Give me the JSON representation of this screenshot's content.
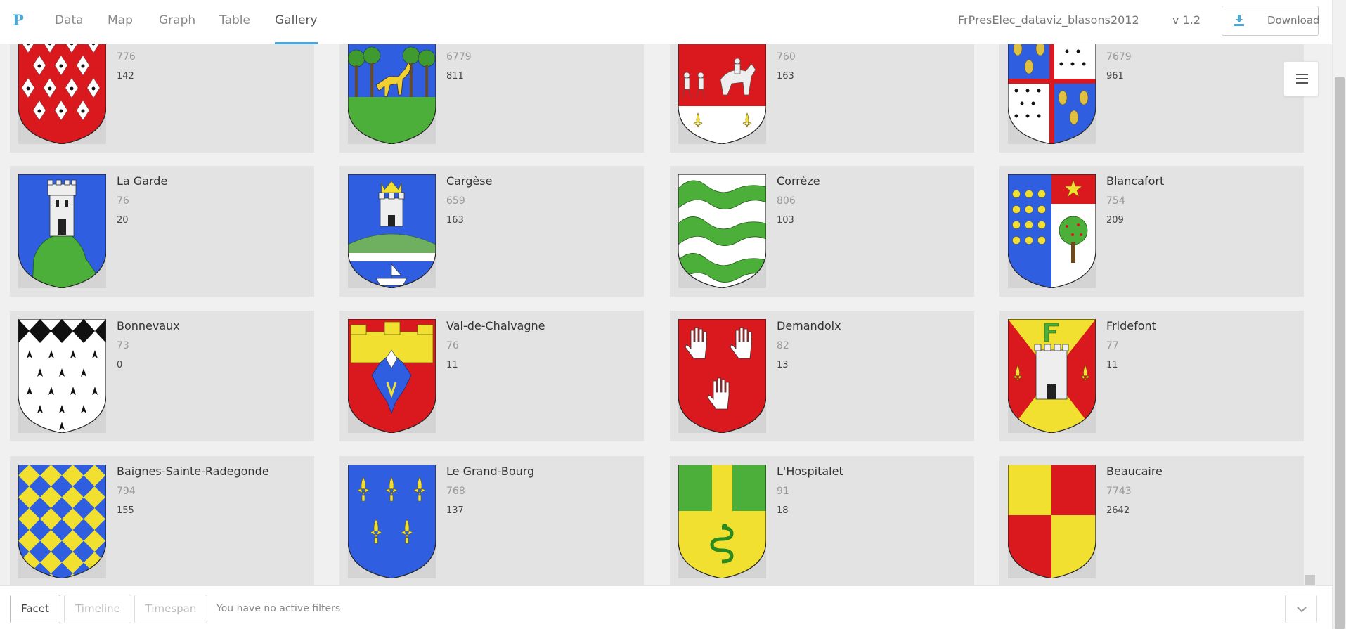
{
  "app": {
    "logo": "P",
    "nav_tabs": [
      "Data",
      "Map",
      "Graph",
      "Table",
      "Gallery"
    ],
    "active_tab": "Gallery",
    "project_title": "FrPresElec_dataviz_blasons2012",
    "version": "v 1.2",
    "download_label": "Download"
  },
  "gallery": {
    "cards": [
      {
        "title": "",
        "v1": "776",
        "v2": "142",
        "icon": "ermine-shield-icon"
      },
      {
        "title": "",
        "v1": "6779",
        "v2": "811",
        "icon": "stag-forest-shield-icon"
      },
      {
        "title": "",
        "v1": "760",
        "v2": "163",
        "icon": "riders-fleur-de-lis-shield-icon"
      },
      {
        "title": "",
        "v1": "7679",
        "v2": "961",
        "icon": "quartered-wheat-ermine-shield-icon"
      },
      {
        "title": "La Garde",
        "v1": "76",
        "v2": "20",
        "icon": "tower-on-rock-shield-icon"
      },
      {
        "title": "Cargèse",
        "v1": "659",
        "v2": "163",
        "icon": "crowned-tower-ship-shield-icon"
      },
      {
        "title": "Corrèze",
        "v1": "806",
        "v2": "103",
        "icon": "green-waves-shield-icon"
      },
      {
        "title": "Blancafort",
        "v1": "754",
        "v2": "209",
        "icon": "bezants-star-tree-shield-icon"
      },
      {
        "title": "Bonnevaux",
        "v1": "73",
        "v2": "0",
        "icon": "ermine-chief-shield-icon"
      },
      {
        "title": "Val-de-Chalvagne",
        "v1": "76",
        "v2": "11",
        "icon": "castle-eagle-shield-icon"
      },
      {
        "title": "Demandolx",
        "v1": "82",
        "v2": "13",
        "icon": "three-hands-shield-icon"
      },
      {
        "title": "Fridefont",
        "v1": "77",
        "v2": "11",
        "icon": "tower-letter-f-shield-icon"
      },
      {
        "title": "Baignes-Sainte-Radegonde",
        "v1": "794",
        "v2": "155",
        "icon": "lozengy-shield-icon"
      },
      {
        "title": "Le Grand-Bourg",
        "v1": "768",
        "v2": "137",
        "icon": "five-fleur-de-lis-shield-icon"
      },
      {
        "title": "L'Hospitalet",
        "v1": "91",
        "v2": "18",
        "icon": "serpent-shield-icon"
      },
      {
        "title": "Beaucaire",
        "v1": "7743",
        "v2": "2642",
        "icon": "quarterly-red-yellow-shield-icon"
      }
    ]
  },
  "footer": {
    "facet_label": "Facet",
    "timeline_label": "Timeline",
    "timespan_label": "Timespan",
    "filters_text": "You have no active filters"
  },
  "colors": {
    "accent": "#4aa8d8",
    "heraldic_red": "#d9191d",
    "heraldic_blue": "#2f5fe0",
    "heraldic_green": "#4caf3a",
    "heraldic_yellow": "#f2e030"
  }
}
